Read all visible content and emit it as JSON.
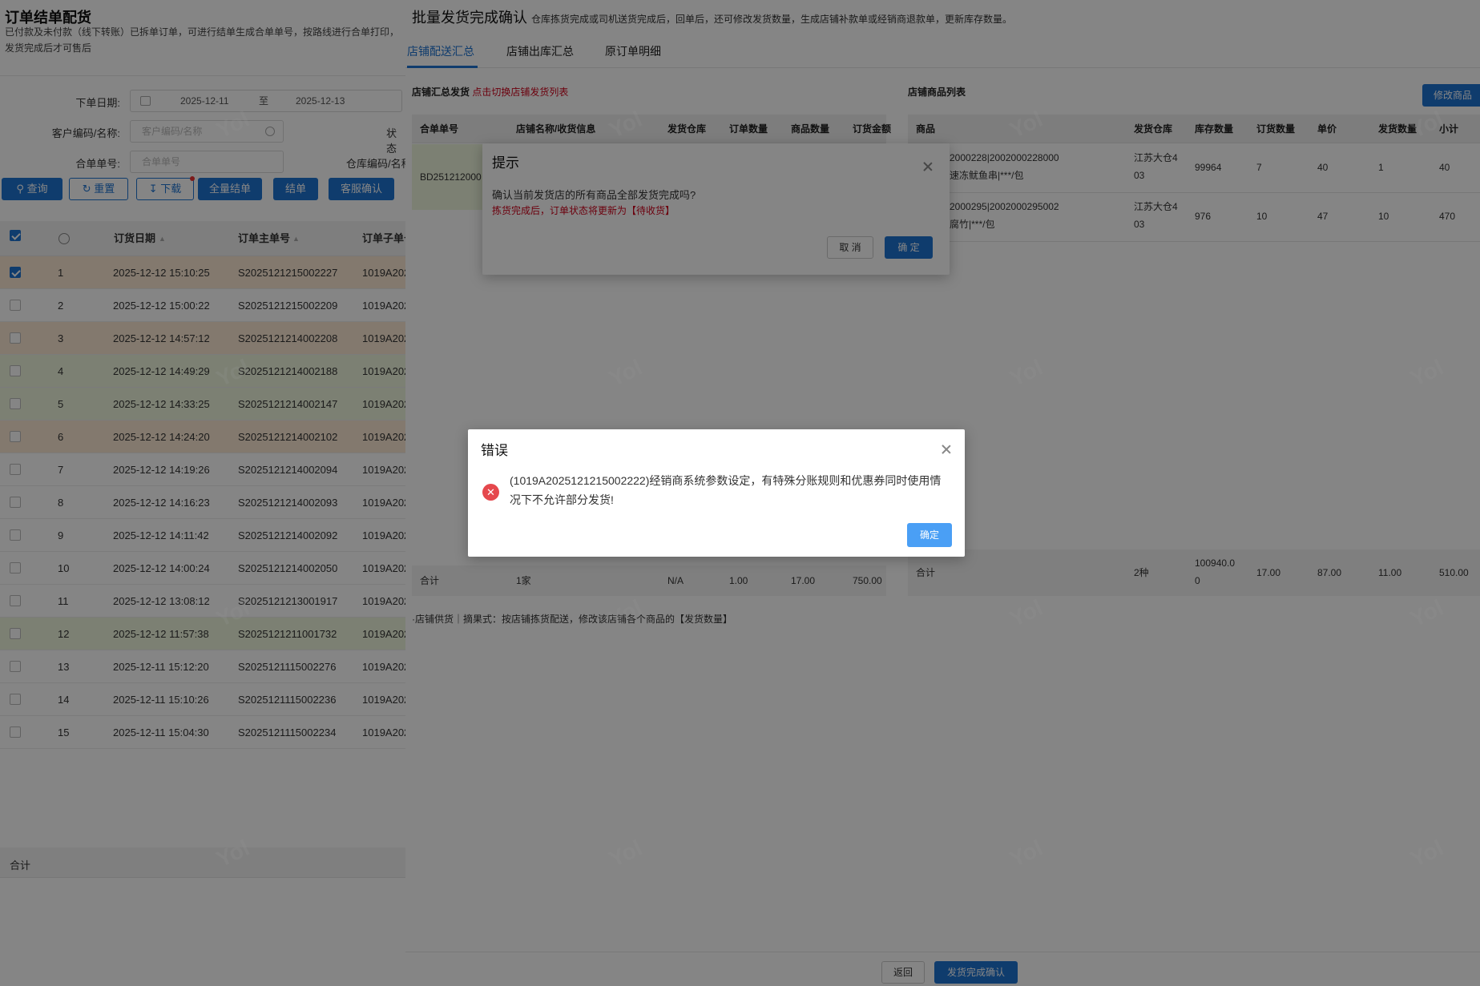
{
  "left": {
    "title": "订单结单配货",
    "desc": "已付款及未付款（线下转账）已拆单订单，可进行结单生成合单单号，按路线进行合单打印，发货完成后才可售后",
    "filters": {
      "date_label": "下单日期:",
      "date_from": "2025-12-11",
      "date_sep": "至",
      "date_to": "2025-12-13",
      "status_label": "状态",
      "customer_label": "客户编码/名称:",
      "customer_placeholder": "客户编码/名称",
      "merge_label": "合单单号:",
      "merge_placeholder": "合单单号",
      "warehouse_label": "仓库编码/名称"
    },
    "buttons": {
      "query": "查询",
      "reset": "重置",
      "download": "下载",
      "all_close": "全量结单",
      "close": "结单",
      "service": "客服确认"
    },
    "table": {
      "headers": {
        "date": "订货日期",
        "main": "订单主单号",
        "sub": "订单子单号"
      },
      "rows": [
        {
          "idx": "1",
          "date": "2025-12-12 15:10:25",
          "main": "S2025121215002227",
          "sub": "1019A202",
          "checked": true,
          "color": "#fbe9d4"
        },
        {
          "idx": "2",
          "date": "2025-12-12 15:00:22",
          "main": "S2025121215002209",
          "sub": "1019A202",
          "checked": false,
          "color": "#ffffff"
        },
        {
          "idx": "3",
          "date": "2025-12-12 14:57:12",
          "main": "S2025121214002208",
          "sub": "1019A202",
          "checked": false,
          "color": "#fbe9d4"
        },
        {
          "idx": "4",
          "date": "2025-12-12 14:49:29",
          "main": "S2025121214002188",
          "sub": "1019A202",
          "checked": false,
          "color": "#eef6dd"
        },
        {
          "idx": "5",
          "date": "2025-12-12 14:33:25",
          "main": "S2025121214002147",
          "sub": "1019A202",
          "checked": false,
          "color": "#eef6dd"
        },
        {
          "idx": "6",
          "date": "2025-12-12 14:24:20",
          "main": "S2025121214002102",
          "sub": "1019A202",
          "checked": false,
          "color": "#fbe9d4"
        },
        {
          "idx": "7",
          "date": "2025-12-12 14:19:26",
          "main": "S2025121214002094",
          "sub": "1019A202",
          "checked": false,
          "color": "#ffffff"
        },
        {
          "idx": "8",
          "date": "2025-12-12 14:16:23",
          "main": "S2025121214002093",
          "sub": "1019A202",
          "checked": false,
          "color": "#ffffff"
        },
        {
          "idx": "9",
          "date": "2025-12-12 14:11:42",
          "main": "S2025121214002092",
          "sub": "1019A202",
          "checked": false,
          "color": "#ffffff"
        },
        {
          "idx": "10",
          "date": "2025-12-12 14:00:24",
          "main": "S2025121214002050",
          "sub": "1019A202",
          "checked": false,
          "color": "#ffffff"
        },
        {
          "idx": "11",
          "date": "2025-12-12 13:08:12",
          "main": "S2025121213001917",
          "sub": "1019A202",
          "checked": false,
          "color": "#ffffff"
        },
        {
          "idx": "12",
          "date": "2025-12-12 11:57:38",
          "main": "S2025121211001732",
          "sub": "1019A202",
          "checked": false,
          "color": "#eef6dd"
        },
        {
          "idx": "13",
          "date": "2025-12-11 15:12:20",
          "main": "S2025121115002276",
          "sub": "1019A202",
          "checked": false,
          "color": "#ffffff"
        },
        {
          "idx": "14",
          "date": "2025-12-11 15:10:26",
          "main": "S2025121115002236",
          "sub": "1019A202",
          "checked": false,
          "color": "#ffffff"
        },
        {
          "idx": "15",
          "date": "2025-12-11 15:04:30",
          "main": "S2025121115002234",
          "sub": "1019A202",
          "checked": false,
          "color": "#ffffff"
        }
      ],
      "total_label": "合计"
    }
  },
  "drawer": {
    "title": "批量发货完成确认",
    "desc": "仓库拣货完成或司机送货完成后，回单后，还可修改发货数量，生成店铺补款单或经销商退款单，更新库存数量。",
    "tabs": [
      "店铺配送汇总",
      "店铺出库汇总",
      "原订单明细"
    ],
    "summary": {
      "title": "店铺汇总发货",
      "switch_link": "点击切换店铺发货列表",
      "headers": [
        "合单单号",
        "店铺名称/收货信息",
        "发货仓库",
        "订单数量",
        "商品数量",
        "订货金额"
      ],
      "row_merge_no": "BD251212000",
      "total": {
        "label": "合计",
        "shops": "1家",
        "warehouse": "N/A",
        "orders": "1.00",
        "goods": "17.00",
        "amount": "750.00"
      }
    },
    "products": {
      "title": "店铺商品列表",
      "edit_btn": "修改商品",
      "headers": [
        "商品",
        "发货仓库",
        "库存数量",
        "订货数量",
        "单价",
        "发货数量",
        "小计"
      ],
      "rows": [
        {
          "code": "2000228|2002000228000",
          "name": "速冻鱿鱼串|***/包",
          "wh1": "江苏大仓4",
          "wh2": "03",
          "stock": "99964",
          "order": "7",
          "price": "40",
          "ship": "1",
          "sub": "40"
        },
        {
          "code": "2000295|2002000295002",
          "name": "腐竹|***/包",
          "wh1": "江苏大仓4",
          "wh2": "03",
          "stock": "976",
          "order": "10",
          "price": "47",
          "ship": "10",
          "sub": "470"
        }
      ],
      "total": {
        "label": "合计",
        "kinds": "2种",
        "stock1": "100940.0",
        "stock2": "0",
        "order": "17.00",
        "price": "87.00",
        "ship": "11.00",
        "sub": "510.00"
      }
    },
    "note": "·店铺供货｜摘果式：按店铺拣货配送，修改该店铺各个商品的【发货数量】",
    "footer": {
      "back": "返回",
      "confirm": "发货完成确认"
    }
  },
  "hint_dialog": {
    "title": "提示",
    "message": "确认当前发货店的所有商品全部发货完成吗?",
    "warning": "拣货完成后，订单状态将更新为【待收货】",
    "cancel": "取 消",
    "ok": "确 定"
  },
  "error_dialog": {
    "title": "错误",
    "message": "(1019A2025121215002222)经销商系统参数设定，有特殊分账规则和优惠券同时使用情况下不允许部分发货!",
    "ok": "确定"
  },
  "watermark": "Yol"
}
